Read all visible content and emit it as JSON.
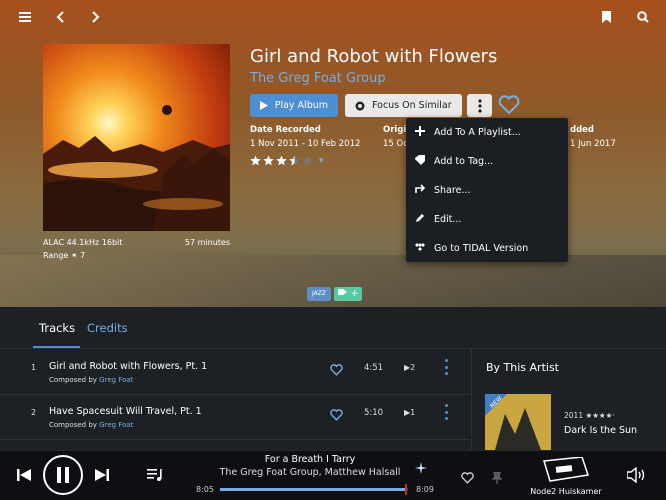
{
  "topbar": {
    "menu_icon": "hamburger-icon",
    "back_icon": "chevron-left-icon",
    "forward_icon": "chevron-right-icon",
    "bookmark_icon": "bookmark-icon",
    "search_icon": "search-icon"
  },
  "album": {
    "title": "Girl and Robot with Flowers",
    "artist": "The Greg Foat Group",
    "format": "ALAC 44.1kHz 16bit",
    "duration": "57 minutes",
    "range": "Range ✶ 7",
    "play_label": "Play Album",
    "focus_label": "Focus On Similar",
    "date_recorded_label": "Date Recorded",
    "date_recorded": "1 Nov 2011 - 10 Feb 2012",
    "original_label": "Origi",
    "original_value": "15 Oc",
    "added_label": "dded",
    "added_value": "1 Jun 2017",
    "rating": 3.5,
    "rating_max": 5,
    "genre": "JAZZ",
    "tag_add": "+"
  },
  "menu": {
    "items": [
      {
        "label": "Add To A Playlist...",
        "icon": "plus-icon"
      },
      {
        "label": "Add to Tag...",
        "icon": "tag-icon"
      },
      {
        "label": "Share...",
        "icon": "share-icon"
      },
      {
        "label": "Edit...",
        "icon": "pencil-icon"
      },
      {
        "label": "Go to TIDAL Version",
        "icon": "tidal-icon"
      }
    ]
  },
  "tabs": {
    "tracks": "Tracks",
    "credits": "Credits"
  },
  "tracks": [
    {
      "num": "1",
      "name": "Girl and Robot with Flowers, Pt. 1",
      "composed_label": "Composed by",
      "composer": "Greg Foat",
      "duration": "4:51",
      "plays": "2"
    },
    {
      "num": "2",
      "name": "Have Spacesuit Will Travel, Pt. 1",
      "composed_label": "Composed by",
      "composer": "Greg Foat",
      "duration": "5:10",
      "plays": "1"
    }
  ],
  "sidebar": {
    "heading": "By This Artist",
    "badge": "NEW",
    "year": "2011 ★★★★·",
    "album": "Dark Is the Sun"
  },
  "player": {
    "title": "For a Breath I Tarry",
    "artist": "The Greg Foat Group, Matthew Halsall",
    "elapsed": "8:05",
    "total": "8:09",
    "progress": 0.99,
    "zone": "Node2 Huiskamer"
  },
  "colors": {
    "accent": "#4d8fd2",
    "link": "#78aee0",
    "panel": "#1d2025",
    "menu": "#1b1e23"
  }
}
